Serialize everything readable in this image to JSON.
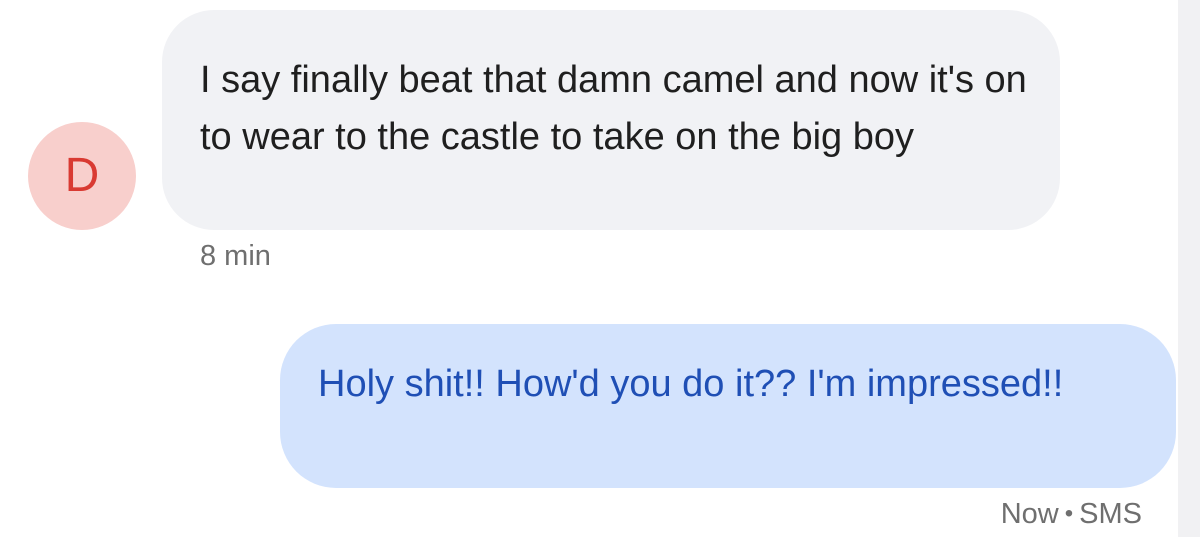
{
  "conversation": {
    "contact": {
      "initial": "D",
      "avatar_color": "#f8cfcc",
      "initial_color": "#d93a32"
    },
    "incoming": {
      "text": "I say finally beat that damn camel and now it's on to wear to the castle to take on the big boy",
      "timestamp": "8 min",
      "bubble_color": "#f1f2f5"
    },
    "outgoing": {
      "text": "Holy shit!! How'd you do it?? I'm impressed!!",
      "timestamp": "Now",
      "separator": "•",
      "channel": "SMS",
      "bubble_color": "#d3e3fd",
      "text_color": "#1f4fb5"
    }
  }
}
